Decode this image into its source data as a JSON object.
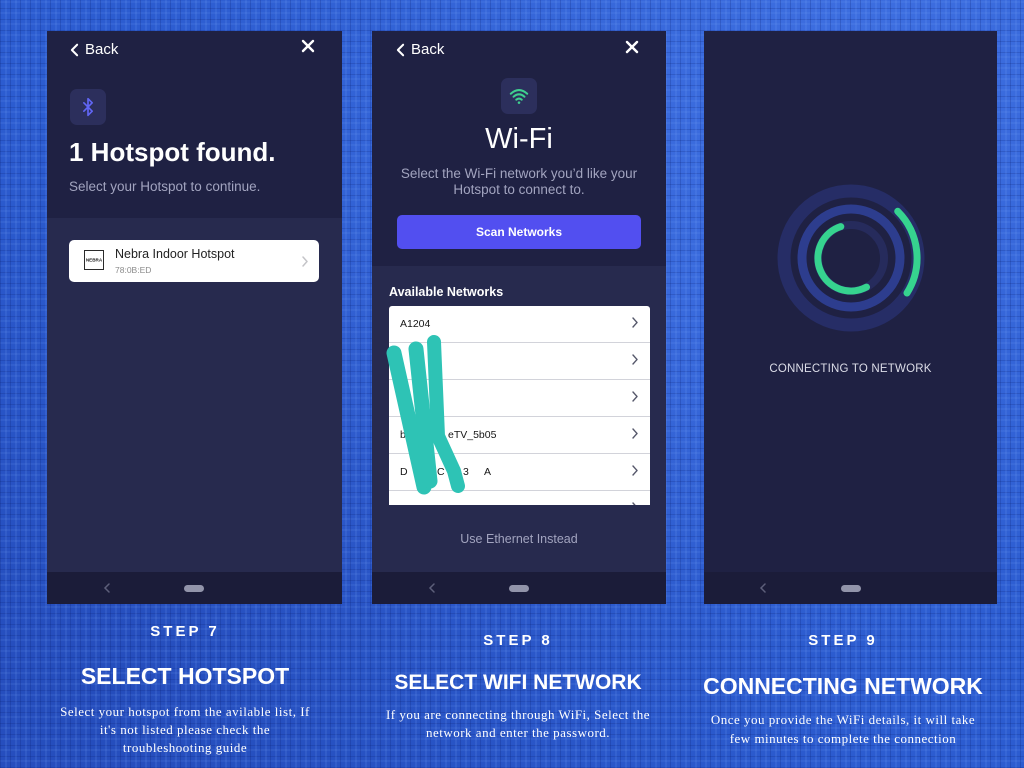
{
  "colors": {
    "page_background": "#2c5cd0",
    "screen_background": "#1f2143",
    "screen_section_background": "#272a4e",
    "nav_bar_background": "#1b1c39",
    "scan_button": "#524ff0",
    "bluetooth_icon": "#6166f5",
    "wifi_icon": "#3fd08f",
    "progress_arc": "#36d38f",
    "ring_outer": "#262d66",
    "ring_middle": "#2d3d8e",
    "ring_inner": "#262b5c",
    "redaction_scribble": "#2ec3b5"
  },
  "step7": {
    "screen": {
      "back_label": "Back",
      "back_icon": "chevron-left-icon",
      "close_icon": "close-icon",
      "header_icon": "bluetooth-icon",
      "title": "1 Hotspot found.",
      "subtitle": "Select your Hotspot to continue.",
      "hotspots": [
        {
          "logo_text": "NEBRA",
          "name": "Nebra Indoor Hotspot",
          "id": "78:0B:ED",
          "action_icon": "chevron-right-icon"
        }
      ],
      "nav_bar": {
        "back_icon": "chevron-left-icon",
        "home_icon": "home-pill-icon"
      }
    },
    "caption": {
      "step": "STEP 7",
      "title": "SELECT HOTSPOT",
      "description": [
        "Select your hotspot from the avilable list, If",
        "it's not listed please check the",
        "troubleshooting guide"
      ]
    }
  },
  "step8": {
    "screen": {
      "back_label": "Back",
      "back_icon": "chevron-left-icon",
      "close_icon": "close-icon",
      "header_icon": "wifi-icon",
      "title": "Wi-Fi",
      "subtitle": [
        "Select the Wi-Fi network you’d like your",
        "Hotspot to connect to."
      ],
      "scan_button": "Scan Networks",
      "list_heading": "Available Networks",
      "row_action_icon": "chevron-right-icon",
      "networks": [
        {
          "name": "A1204"
        },
        {
          "redacted": true
        },
        {
          "redacted": true
        },
        {
          "redacted": true,
          "visible_fragments": [
            "b",
            "eTV_5b05"
          ]
        },
        {
          "redacted": true,
          "visible_fragments": [
            "D",
            "C",
            "3",
            "A"
          ]
        },
        {}
      ],
      "ethernet_link": "Use Ethernet Instead",
      "nav_bar": {
        "back_icon": "chevron-left-icon",
        "home_icon": "home-pill-icon"
      }
    },
    "caption": {
      "step": "STEP 8",
      "title": "SELECT WIFI NETWORK",
      "description": [
        "If you are connecting through WiFi, Select the",
        "network and enter the password."
      ]
    }
  },
  "step9": {
    "screen": {
      "status": "CONNECTING TO NETWORK",
      "progress_icon": "connection-rings-icon",
      "nav_bar": {
        "back_icon": "chevron-left-icon",
        "home_icon": "home-pill-icon"
      }
    },
    "caption": {
      "step": "STEP 9",
      "title": "CONNECTING NETWORK",
      "description": [
        "Once you provide the WiFi details, it will take",
        "few minutes to complete the connection"
      ]
    }
  }
}
